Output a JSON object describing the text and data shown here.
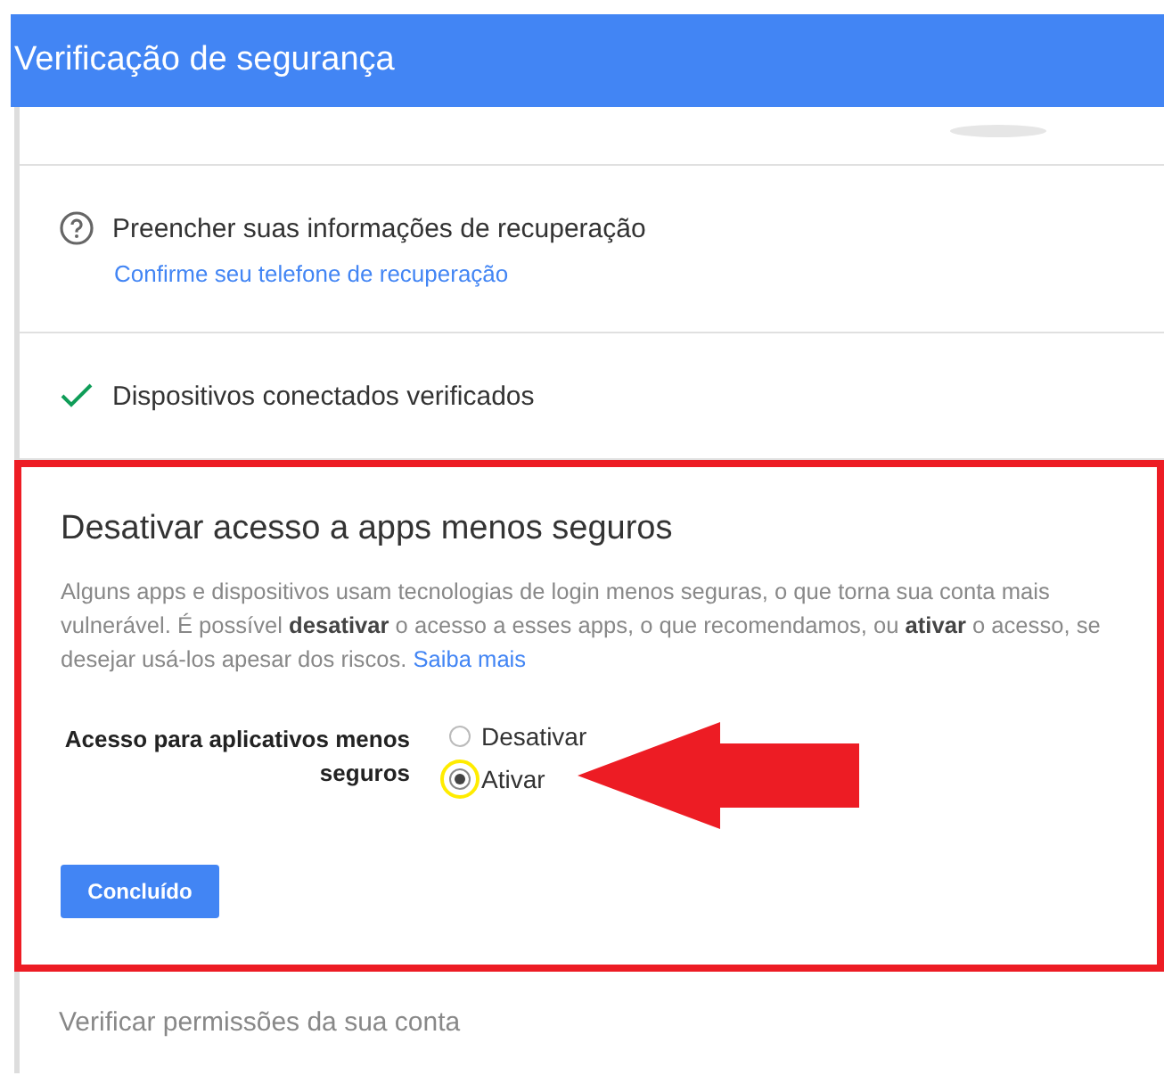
{
  "header": {
    "title": "Verificação de segurança"
  },
  "items": [
    {
      "kind": "warning",
      "title": "Preencher suas informações de recuperação",
      "link": "Confirme seu telefone de recuperação"
    },
    {
      "kind": "done",
      "title": "Dispositivos conectados verificados"
    }
  ],
  "section": {
    "highlighted": true,
    "title": "Desativar acesso a apps menos seguros",
    "description": "Alguns apps e dispositivos usam tecnologias de login menos seguras, o que torna sua conta mais vulnerável. É possível **desativar** o acesso a esses apps, o que recomendamos, ou **ativar** o acesso, se desejar usá-los apesar dos riscos.",
    "link": "Saiba mais",
    "setting_label": "Acesso para aplicativos menos seguros",
    "options": [
      {
        "label": "Desativar",
        "selected": false,
        "circled": false
      },
      {
        "label": "Ativar",
        "selected": true,
        "circled": true
      }
    ],
    "button": "Concluído"
  },
  "footer_item": {
    "title": "Verificar permissões da sua conta"
  }
}
